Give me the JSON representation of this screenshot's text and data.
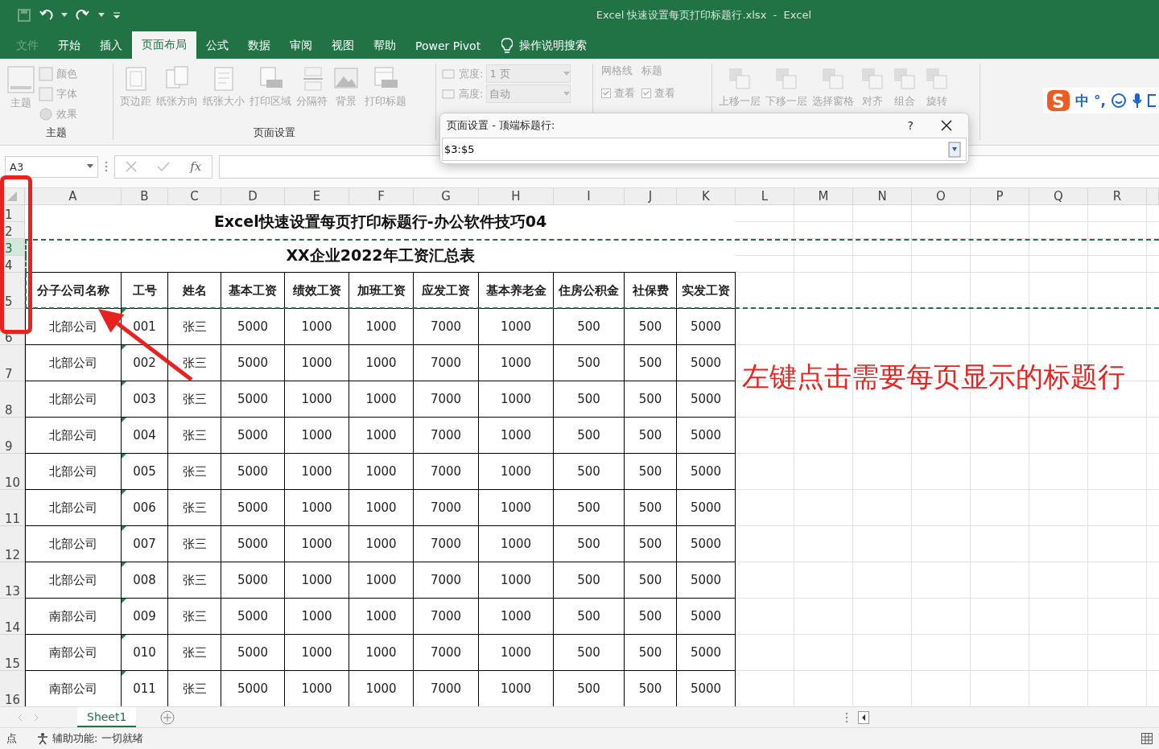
{
  "window": {
    "title": "Excel 快速设置每页打印标题行.xlsx  -  Excel"
  },
  "tabs": [
    {
      "label": "文件",
      "selected": false,
      "disabled": true
    },
    {
      "label": "开始",
      "selected": false,
      "disabled": false
    },
    {
      "label": "插入",
      "selected": false,
      "disabled": false
    },
    {
      "label": "页面布局",
      "selected": true,
      "disabled": false
    },
    {
      "label": "公式",
      "selected": false,
      "disabled": false
    },
    {
      "label": "数据",
      "selected": false,
      "disabled": false
    },
    {
      "label": "审阅",
      "selected": false,
      "disabled": false
    },
    {
      "label": "视图",
      "selected": false,
      "disabled": false
    },
    {
      "label": "帮助",
      "selected": false,
      "disabled": false
    },
    {
      "label": "Power Pivot",
      "selected": false,
      "disabled": false
    }
  ],
  "tell_me": "操作说明搜索",
  "ribbon": {
    "disabled": true,
    "theme_group": {
      "label": "主题",
      "main": "主题",
      "items": [
        "颜色",
        "字体",
        "效果"
      ]
    },
    "page_setup_group": {
      "label": "页面设置",
      "buttons": [
        "页边距",
        "纸张方向",
        "纸张大小",
        "打印区域",
        "分隔符",
        "背景",
        "打印标题"
      ]
    },
    "scale_rows": [
      {
        "label": "宽度:",
        "value": "1 页"
      },
      {
        "label": "高度:",
        "value": "自动"
      }
    ],
    "sheet_options": [
      {
        "title": "网格线",
        "label": "查看",
        "checked": true
      },
      {
        "title": "标题",
        "label": "查看",
        "checked": true
      }
    ],
    "arrange_buttons": [
      "上移一层",
      "下移一层",
      "选择窗格",
      "对齐",
      "组合",
      "旋转"
    ]
  },
  "ime_bar": {
    "mode": "中",
    "punctuation": "°,"
  },
  "formula_bar": {
    "name_box": "A3",
    "function_label": "fx"
  },
  "dialog": {
    "title": "页面设置 - 顶端标题行:",
    "help": "?",
    "value": "$3:$5"
  },
  "sheet": {
    "columns": [
      "A",
      "B",
      "C",
      "D",
      "E",
      "F",
      "G",
      "H",
      "I",
      "J",
      "K",
      "L",
      "M",
      "N",
      "O",
      "P",
      "Q",
      "R"
    ],
    "rows": [
      {
        "label": "1",
        "selected": false,
        "print_title": false
      },
      {
        "label": "2",
        "selected": false,
        "print_title": false
      },
      {
        "label": "3",
        "selected": true,
        "print_title": true
      },
      {
        "label": "4",
        "selected": false,
        "print_title": true
      },
      {
        "label": "5",
        "selected": false,
        "print_title": true
      },
      {
        "label": "6",
        "selected": false,
        "print_title": false
      },
      {
        "label": "7",
        "selected": false,
        "print_title": false
      },
      {
        "label": "8",
        "selected": false,
        "print_title": false
      },
      {
        "label": "9",
        "selected": false,
        "print_title": false
      },
      {
        "label": "10",
        "selected": false,
        "print_title": false
      },
      {
        "label": "11",
        "selected": false,
        "print_title": false
      },
      {
        "label": "12",
        "selected": false,
        "print_title": false
      },
      {
        "label": "13",
        "selected": false,
        "print_title": false
      },
      {
        "label": "14",
        "selected": false,
        "print_title": false
      },
      {
        "label": "15",
        "selected": false,
        "print_title": false
      },
      {
        "label": "16",
        "selected": false,
        "print_title": false
      }
    ],
    "title": "Excel快速设置每页打印标题行-办公软件技巧04",
    "subtitle": "XX企业2022年工资汇总表",
    "headers": [
      "分子公司名称",
      "工号",
      "姓名",
      "基本工资",
      "绩效工资",
      "加班工资",
      "应发工资",
      "基本养老金",
      "住房公积金",
      "社保费",
      "实发工资"
    ],
    "data": [
      {
        "flagged": true,
        "cells": [
          "北部公司",
          "001",
          "张三",
          "5000",
          "1000",
          "1000",
          "7000",
          "1000",
          "500",
          "500",
          "5000"
        ]
      },
      {
        "flagged": true,
        "cells": [
          "北部公司",
          "002",
          "张三",
          "5000",
          "1000",
          "1000",
          "7000",
          "1000",
          "500",
          "500",
          "5000"
        ]
      },
      {
        "flagged": true,
        "cells": [
          "北部公司",
          "003",
          "张三",
          "5000",
          "1000",
          "1000",
          "7000",
          "1000",
          "500",
          "500",
          "5000"
        ]
      },
      {
        "flagged": true,
        "cells": [
          "北部公司",
          "004",
          "张三",
          "5000",
          "1000",
          "1000",
          "7000",
          "1000",
          "500",
          "500",
          "5000"
        ]
      },
      {
        "flagged": true,
        "cells": [
          "北部公司",
          "005",
          "张三",
          "5000",
          "1000",
          "1000",
          "7000",
          "1000",
          "500",
          "500",
          "5000"
        ]
      },
      {
        "flagged": true,
        "cells": [
          "北部公司",
          "006",
          "张三",
          "5000",
          "1000",
          "1000",
          "7000",
          "1000",
          "500",
          "500",
          "5000"
        ]
      },
      {
        "flagged": true,
        "cells": [
          "北部公司",
          "007",
          "张三",
          "5000",
          "1000",
          "1000",
          "7000",
          "1000",
          "500",
          "500",
          "5000"
        ]
      },
      {
        "flagged": true,
        "cells": [
          "北部公司",
          "008",
          "张三",
          "5000",
          "1000",
          "1000",
          "7000",
          "1000",
          "500",
          "500",
          "5000"
        ]
      },
      {
        "flagged": true,
        "cells": [
          "南部公司",
          "009",
          "张三",
          "5000",
          "1000",
          "1000",
          "7000",
          "1000",
          "500",
          "500",
          "5000"
        ]
      },
      {
        "flagged": true,
        "cells": [
          "南部公司",
          "010",
          "张三",
          "5000",
          "1000",
          "1000",
          "7000",
          "1000",
          "500",
          "500",
          "5000"
        ]
      },
      {
        "flagged": true,
        "cells": [
          "南部公司",
          "011",
          "张三",
          "5000",
          "1000",
          "1000",
          "7000",
          "1000",
          "500",
          "500",
          "5000"
        ]
      }
    ]
  },
  "sheet_tabs": [
    {
      "label": "Sheet1",
      "selected": true
    }
  ],
  "status_bar": {
    "mode": "点",
    "accessibility": "辅助功能: 一切就绪"
  },
  "annotation": {
    "text": "左键点击需要每页显示的标题行"
  }
}
